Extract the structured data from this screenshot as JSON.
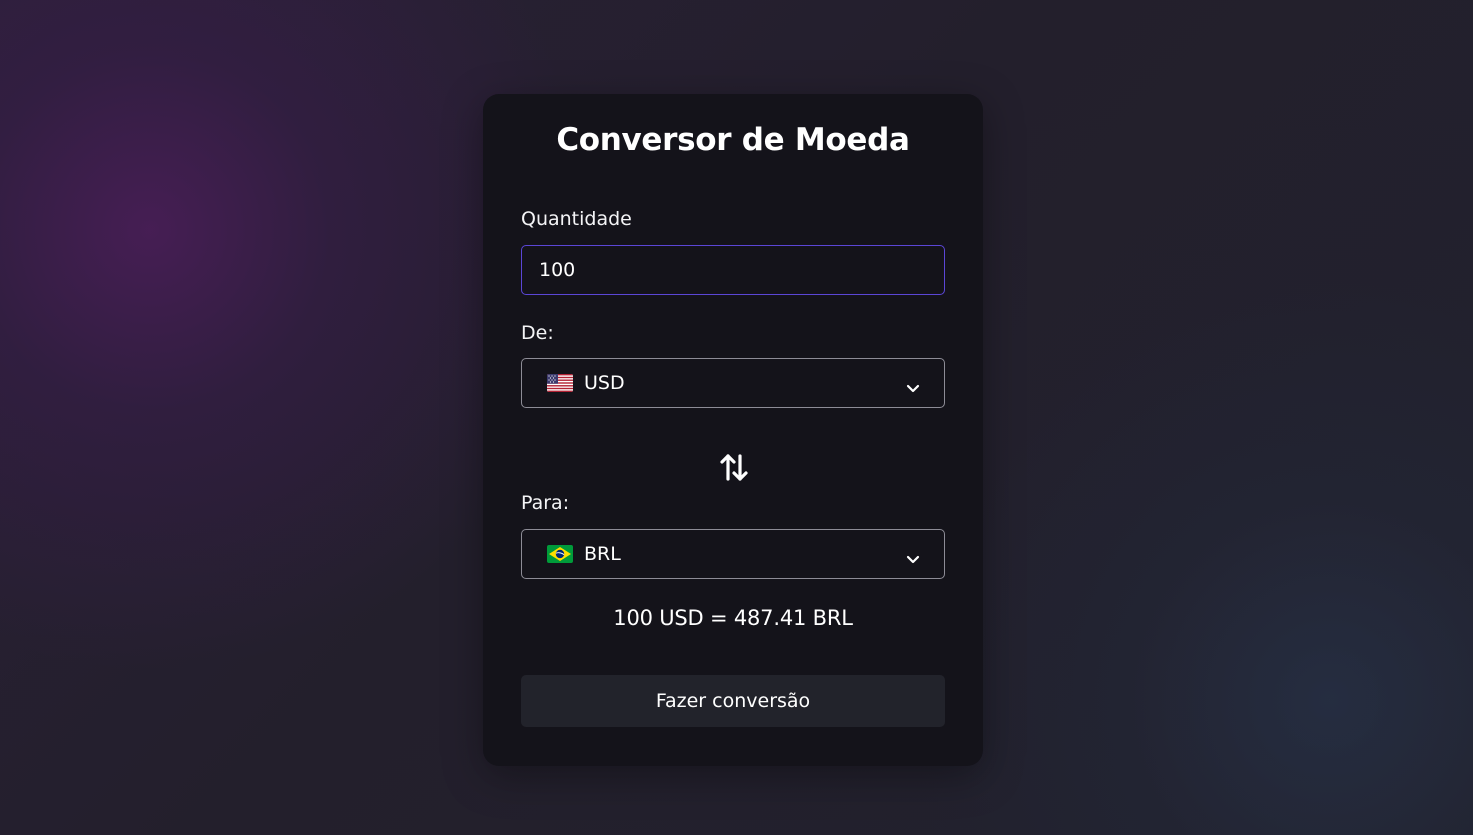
{
  "converter": {
    "title": "Conversor de Moeda",
    "amount_label": "Quantidade",
    "amount_value": "100",
    "from_label": "De:",
    "from_currency": "USD",
    "from_flag_icon": "us-flag-icon",
    "to_label": "Para:",
    "to_currency": "BRL",
    "to_flag_icon": "brazil-flag-icon",
    "swap_icon": "swap-arrows-icon",
    "result_text": "100 USD = 487.41 BRL",
    "convert_button_label": "Fazer conversão"
  },
  "colors": {
    "card_background": "#14131a",
    "input_focus_border": "#5b46d6",
    "select_border": "#8d8c96",
    "button_background": "#22232b",
    "text": "#ffffff"
  }
}
